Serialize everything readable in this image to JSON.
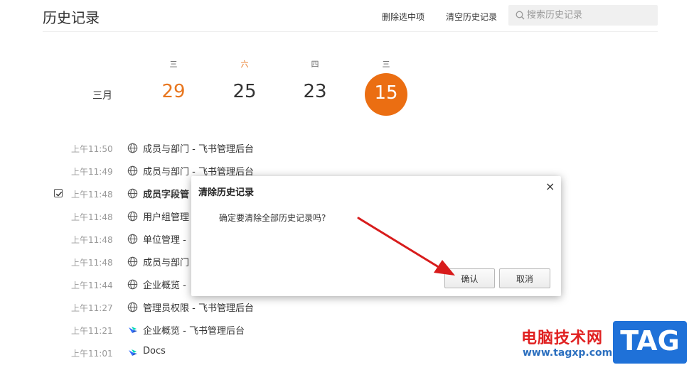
{
  "header": {
    "title": "历史记录",
    "delete_selected": "删除选中项",
    "clear_history": "清空历史记录",
    "search_placeholder": "搜索历史记录"
  },
  "calendar": {
    "month": "三月",
    "days": [
      {
        "weekday": "三",
        "date": "29"
      },
      {
        "weekday": "六",
        "date": "25"
      },
      {
        "weekday": "四",
        "date": "23"
      },
      {
        "weekday": "三",
        "date": "15"
      }
    ]
  },
  "history": [
    {
      "time": "上午11:50",
      "title": "成员与部门 - 飞书管理后台",
      "icon": "globe-icon"
    },
    {
      "time": "上午11:49",
      "title": "成员与部门 - 飞书管理后台",
      "icon": "globe-icon"
    },
    {
      "time": "上午11:48",
      "title": "成员字段管",
      "icon": "globe-icon",
      "checked": true
    },
    {
      "time": "上午11:48",
      "title": "用户组管理",
      "icon": "globe-icon"
    },
    {
      "time": "上午11:48",
      "title": "单位管理 -",
      "icon": "globe-icon"
    },
    {
      "time": "上午11:48",
      "title": "成员与部门",
      "icon": "globe-icon"
    },
    {
      "time": "上午11:44",
      "title": "企业概览 -",
      "icon": "globe-icon"
    },
    {
      "time": "上午11:27",
      "title": "管理员权限 - 飞书管理后台",
      "icon": "globe-icon"
    },
    {
      "time": "上午11:21",
      "title": "企业概览 - 飞书管理后台",
      "icon": "feishu-icon"
    },
    {
      "time": "上午11:01",
      "title": "Docs",
      "icon": "feishu-icon"
    }
  ],
  "dialog": {
    "title": "清除历史记录",
    "close": "×",
    "message": "确定要清除全部历史记录吗?",
    "confirm": "确认",
    "cancel": "取消"
  },
  "watermark": {
    "text": "电脑技术网",
    "url": "www.tagxp.com",
    "badge": "TAG"
  },
  "colors": {
    "accent_orange": "#eb6e12",
    "arrow_red": "#d81c1c",
    "watermark_blue": "#1f71d8"
  }
}
